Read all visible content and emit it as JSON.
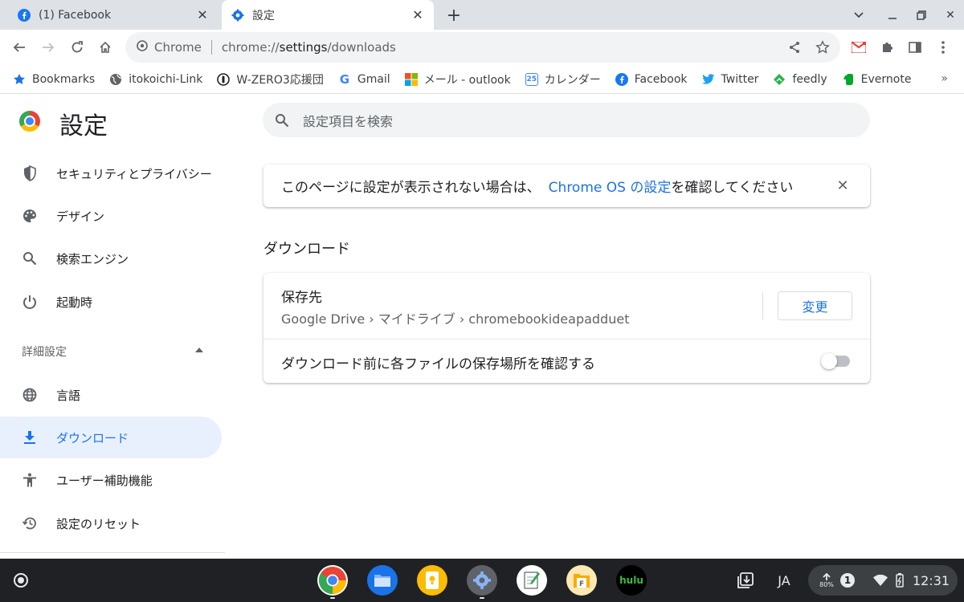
{
  "tabs": [
    {
      "title": "(1) Facebook"
    },
    {
      "title": "設定"
    }
  ],
  "toolbar": {
    "chip_label": "Chrome",
    "url_prefix": "chrome://",
    "url_host": "settings",
    "url_path": "/downloads"
  },
  "bookmarks": {
    "items": [
      {
        "label": "Bookmarks"
      },
      {
        "label": "itokoichi-Link"
      },
      {
        "label": "W-ZERO3応援団"
      },
      {
        "label": "Gmail"
      },
      {
        "label": "メール - outlook"
      },
      {
        "label": "カレンダー"
      },
      {
        "label": "Facebook"
      },
      {
        "label": "Twitter"
      },
      {
        "label": "feedly"
      },
      {
        "label": "Evernote"
      }
    ],
    "calendar_icon_text": "25"
  },
  "settings": {
    "title": "設定",
    "search_placeholder": "設定項目を検索",
    "nav": [
      {
        "label": "セキュリティとプライバシー"
      },
      {
        "label": "デザイン"
      },
      {
        "label": "検索エンジン"
      },
      {
        "label": "起動時"
      }
    ],
    "advanced_label": "詳細設定",
    "advanced_nav": [
      {
        "label": "言語"
      },
      {
        "label": "ダウンロード"
      },
      {
        "label": "ユーザー補助機能"
      },
      {
        "label": "設定のリセット"
      }
    ],
    "notice_before": "このページに設定が表示されない場合は、",
    "notice_link": "Chrome OS の設定",
    "notice_after": "を確認してください",
    "section_title": "ダウンロード",
    "location_label": "保存先",
    "location_value": "Google Drive › マイドライブ › chromebookideapadduet",
    "change_button": "変更",
    "ask_label": "ダウンロード前に各ファイルの保存場所を確認する",
    "ask_enabled": false
  },
  "shelf": {
    "apps": [
      "chrome",
      "files",
      "keep",
      "settings",
      "notepad",
      "file-manager",
      "hulu"
    ],
    "hulu_label": "hulu",
    "ime": "JA",
    "battery_text": "80%",
    "notification_count": "1",
    "time": "12:31"
  },
  "colors": {
    "accent": "#1a73e8",
    "selected_bg": "#e8f0fe",
    "tabstrip": "#dee1e6",
    "shelf": "#202124"
  }
}
